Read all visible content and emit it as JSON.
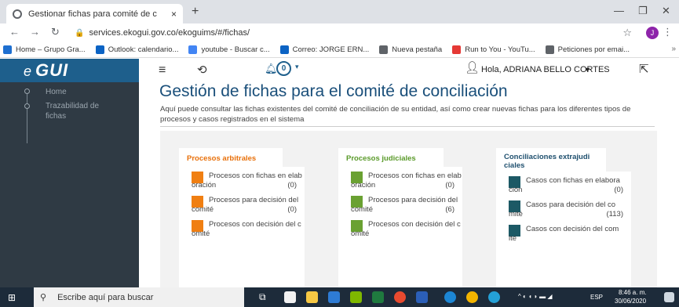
{
  "browser": {
    "tab_title": "Gestionar fichas para comité de c",
    "tab_close": "×",
    "new_tab": "+",
    "url": "services.ekogui.gov.co/ekoguims/#/fichas/",
    "profile_initial": "J",
    "bookmarks": [
      {
        "label": "Home – Grupo Gra...",
        "color": "#1e6fd0"
      },
      {
        "label": "Outlook: calendario...",
        "color": "#0b63c4"
      },
      {
        "label": "youtube - Buscar c...",
        "color": "#4285f4"
      },
      {
        "label": "Correo: JORGE ERN...",
        "color": "#0b63c4"
      },
      {
        "label": "Nueva pestaña",
        "color": "#5f6368"
      },
      {
        "label": "Run to You - YouTu...",
        "color": "#e53935"
      },
      {
        "label": "Peticiones por emai...",
        "color": "#5f6368"
      }
    ],
    "bookmarks_more": "»"
  },
  "app": {
    "logo_e": "e",
    "logo_text": "GUI",
    "sidebar": [
      {
        "label": "Home"
      },
      {
        "label": "Trazabilidad de fichas"
      }
    ],
    "notifications_count": "0",
    "user_greeting": "Hola, ADRIANA BELLO CORTES",
    "page_title": "Gestión de fichas para el comité de conciliación",
    "page_description": "Aquí puede consultar las fichas existentes del comité de conciliación de su entidad, así como crear nuevas fichas para los diferentes tipos de procesos y casos registrados en el sistema",
    "columns": [
      {
        "title": "Procesos arbitrales",
        "title_color": "#e8700a",
        "card_color": "#f07f12",
        "cards": [
          {
            "line1": "Procesos con fichas en elab",
            "line2": "oración",
            "count": "(0)"
          },
          {
            "line1": "Procesos para decisión del",
            "line2": "comité",
            "count": "(0)"
          },
          {
            "line1": "Procesos con decisión del c",
            "line2": "omité",
            "count": ""
          }
        ]
      },
      {
        "title": "Procesos judiciales",
        "title_color": "#5a9a2a",
        "card_color": "#6aa132",
        "cards": [
          {
            "line1": "Procesos con fichas en elab",
            "line2": "oración",
            "count": "(0)"
          },
          {
            "line1": "Procesos para decisión del",
            "line2": "comité",
            "count": "(6)"
          },
          {
            "line1": "Procesos con decisión del c",
            "line2": "omité",
            "count": ""
          }
        ]
      },
      {
        "title": "Conciliaciones extrajudi ciales",
        "title_line1": "Conciliaciones extrajudi",
        "title_line2": "ciales",
        "title_color": "#1e4f6e",
        "card_color": "#1c5965",
        "cards": [
          {
            "line1": "Casos con fichas en elabora",
            "line2": "ción",
            "count": "(0)"
          },
          {
            "line1": "Casos para decisión del co",
            "line2": "mité",
            "count": "(113)"
          },
          {
            "line1": "Casos con decisión del com",
            "line2": "ité",
            "count": ""
          }
        ]
      }
    ]
  },
  "taskbar": {
    "search_placeholder": "Escribe aquí para buscar",
    "language": "ESP",
    "time": "8:46 a. m.",
    "date": "30/06/2020"
  }
}
